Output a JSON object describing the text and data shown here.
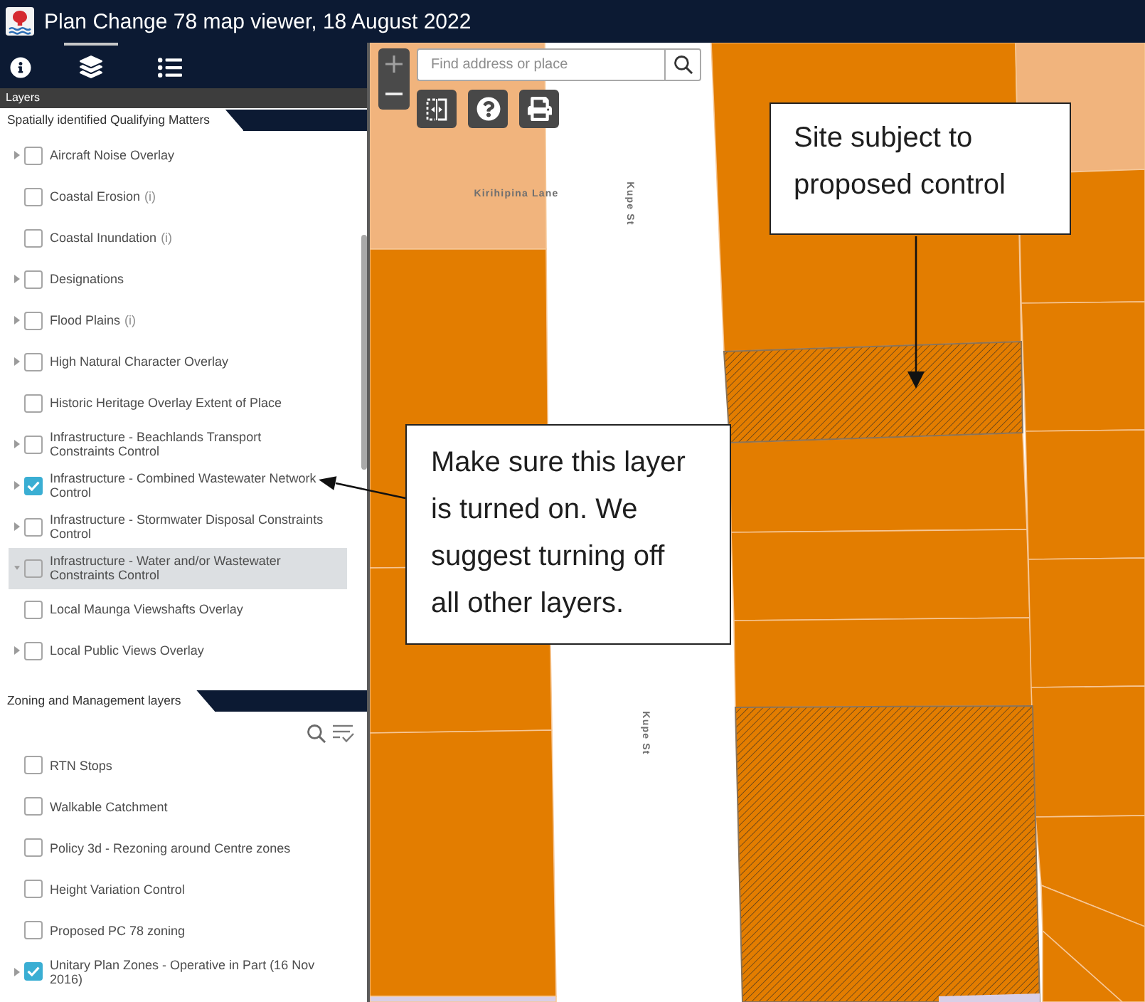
{
  "header": {
    "title": "Plan Change 78 map viewer, 18 August 2022"
  },
  "sidebar": {
    "tabs": [
      {
        "kind": "info",
        "selected": false
      },
      {
        "kind": "layers",
        "selected": true
      },
      {
        "kind": "legend",
        "selected": false
      }
    ],
    "panel_title": "Layers",
    "sections": [
      {
        "title": "Spatially identified Qualifying Matters",
        "filter_bar": false,
        "scrollable": true,
        "layers": [
          {
            "kind": "group",
            "name": "Aircraft Noise Overlay",
            "expanded": false,
            "checked": false,
            "highlighted": false
          },
          {
            "kind": "layer",
            "name": "Coastal Erosion",
            "note": "(i)",
            "checked": false,
            "highlighted": false
          },
          {
            "kind": "layer",
            "name": "Coastal Inundation",
            "note": "(i)",
            "checked": false,
            "highlighted": false
          },
          {
            "kind": "group",
            "name": "Designations",
            "expanded": false,
            "checked": false,
            "highlighted": false
          },
          {
            "kind": "group",
            "name": "Flood Plains",
            "note": "(i)",
            "expanded": false,
            "checked": false,
            "highlighted": false
          },
          {
            "kind": "group",
            "name": "High Natural Character Overlay",
            "expanded": false,
            "checked": false,
            "highlighted": false
          },
          {
            "kind": "layer",
            "name": "Historic Heritage Overlay Extent of Place",
            "checked": false,
            "highlighted": false
          },
          {
            "kind": "group",
            "name": "Infrastructure - Beachlands Transport Constraints Control",
            "expanded": false,
            "checked": false,
            "highlighted": false
          },
          {
            "kind": "group",
            "name": "Infrastructure - Combined Wastewater Network Control",
            "expanded": false,
            "checked": true,
            "highlighted": false
          },
          {
            "kind": "group",
            "name": "Infrastructure - Stormwater Disposal Constraints Control",
            "expanded": false,
            "checked": false,
            "highlighted": false
          },
          {
            "kind": "group",
            "name": "Infrastructure - Water and/or Wastewater Constraints Control",
            "expanded": true,
            "checked": false,
            "highlighted": true
          },
          {
            "kind": "layer",
            "name": "Local Maunga Viewshafts Overlay",
            "checked": false,
            "highlighted": false
          },
          {
            "kind": "group",
            "name": "Local Public Views Overlay",
            "expanded": false,
            "checked": false,
            "highlighted": false
          }
        ]
      },
      {
        "title": "Zoning and Management layers",
        "filter_bar": true,
        "scrollable": false,
        "layers": [
          {
            "kind": "layer",
            "name": "RTN Stops",
            "checked": false,
            "highlighted": false
          },
          {
            "kind": "layer",
            "name": "Walkable Catchment",
            "checked": false,
            "highlighted": false
          },
          {
            "kind": "layer",
            "name": "Policy 3d - Rezoning around Centre zones",
            "checked": false,
            "highlighted": false
          },
          {
            "kind": "layer",
            "name": "Height Variation Control",
            "checked": false,
            "highlighted": false
          },
          {
            "kind": "layer",
            "name": "Proposed PC 78 zoning",
            "checked": false,
            "highlighted": false
          },
          {
            "kind": "group",
            "name": "Unitary Plan Zones - Operative in Part (16 Nov 2016)",
            "expanded": false,
            "checked": true,
            "highlighted": false
          }
        ]
      }
    ]
  },
  "map": {
    "zoom_buttons": [
      {
        "kind": "in",
        "disabled": true
      },
      {
        "kind": "out",
        "disabled": false
      }
    ],
    "search": {
      "placeholder": "Find address or place"
    },
    "tools": [
      {
        "kind": "swipe"
      },
      {
        "kind": "help"
      },
      {
        "kind": "print"
      }
    ],
    "street_labels": [
      {
        "text": "Kirihipina Lane",
        "vertical": false
      },
      {
        "text": "Kupe St",
        "vertical": true
      },
      {
        "text": "Kupe St",
        "vertical": true
      }
    ]
  },
  "callouts": [
    {
      "text": "Site subject to proposed control"
    },
    {
      "text": "Make sure this layer is turned on. We suggest turning off all other layers."
    }
  ]
}
